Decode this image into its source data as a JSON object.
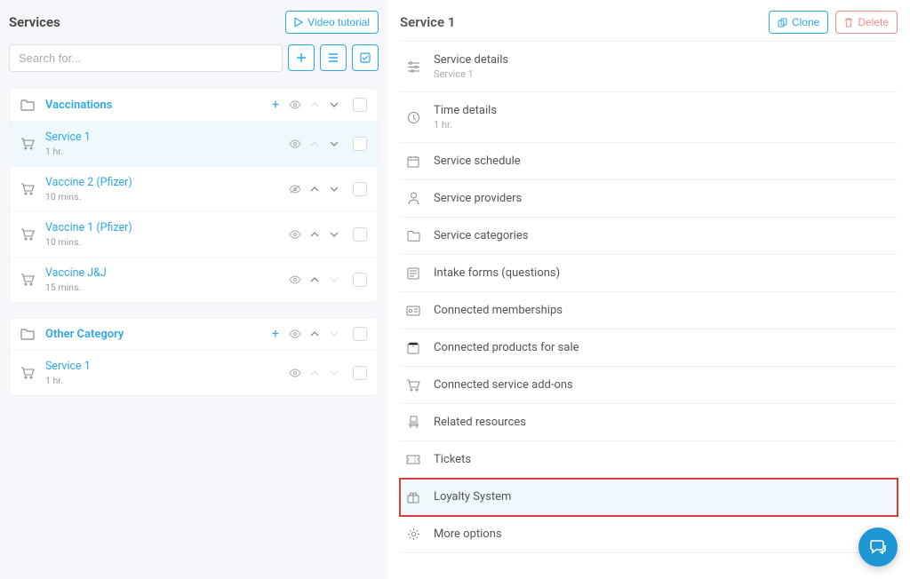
{
  "left": {
    "title": "Services",
    "video_tutorial": "Video tutorial",
    "search_placeholder": "Search for...",
    "categories": [
      {
        "name": "Vaccinations",
        "services": [
          {
            "name": "Service 1",
            "sub": "1 hr.",
            "selected": true
          },
          {
            "name": "Vaccine 2 (Pfizer)",
            "sub": "10 mins."
          },
          {
            "name": "Vaccine 1 (Pfizer)",
            "sub": "10 mins."
          },
          {
            "name": "Vaccine J&J",
            "sub": "15 mins."
          }
        ]
      },
      {
        "name": "Other Category",
        "services": [
          {
            "name": "Service 1",
            "sub": "1 hr."
          }
        ]
      }
    ]
  },
  "right": {
    "title": "Service 1",
    "clone": "Clone",
    "delete": "Delete",
    "sections": [
      {
        "icon": "sliders",
        "name": "Service details",
        "sub": "Service 1"
      },
      {
        "icon": "clock",
        "name": "Time details",
        "sub": "1 hr."
      },
      {
        "icon": "calendar",
        "name": "Service schedule"
      },
      {
        "icon": "user",
        "name": "Service providers"
      },
      {
        "icon": "folder",
        "name": "Service categories"
      },
      {
        "icon": "form",
        "name": "Intake forms (questions)"
      },
      {
        "icon": "membership",
        "name": "Connected memberships"
      },
      {
        "icon": "box",
        "name": "Connected products for sale"
      },
      {
        "icon": "cart",
        "name": "Connected service add-ons"
      },
      {
        "icon": "chair",
        "name": "Related resources"
      },
      {
        "icon": "ticket",
        "name": "Tickets"
      },
      {
        "icon": "gift",
        "name": "Loyalty System",
        "highlight": true
      },
      {
        "icon": "gear",
        "name": "More options"
      }
    ]
  }
}
